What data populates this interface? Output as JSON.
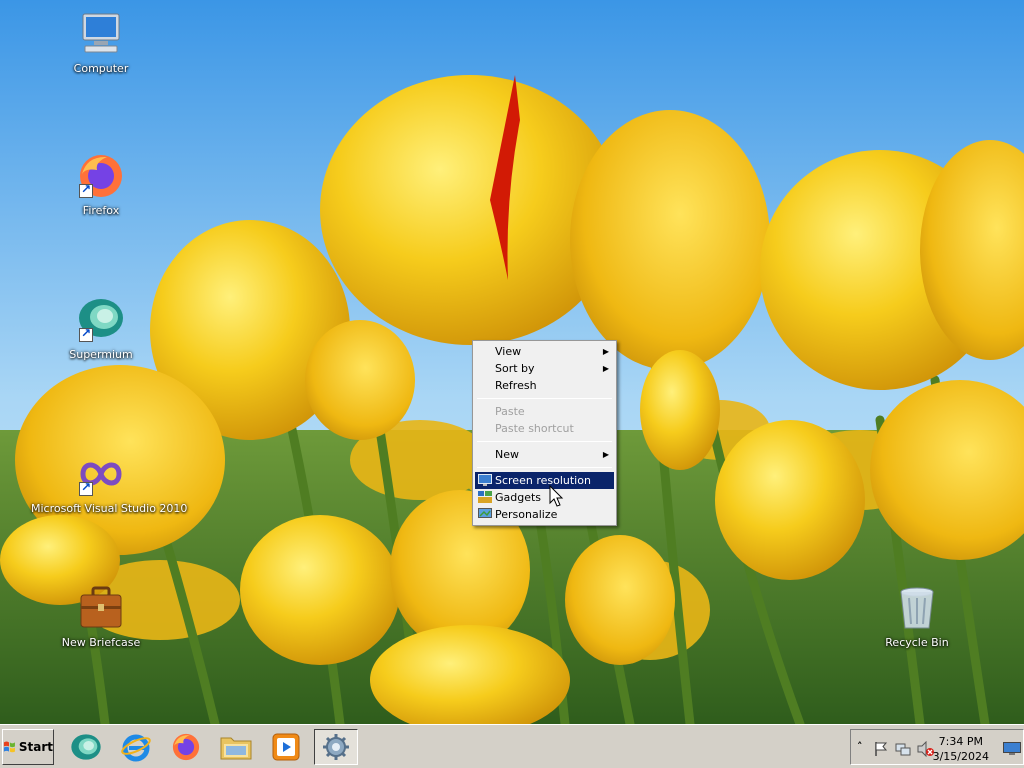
{
  "desktop": {
    "icons": [
      {
        "label": "Computer",
        "icon": "computer-icon"
      },
      {
        "label": "Firefox",
        "icon": "firefox-icon"
      },
      {
        "label": "Supermium",
        "icon": "supermium-icon"
      },
      {
        "label": "Microsoft Visual Studio 2010",
        "icon": "visual-studio-icon"
      },
      {
        "label": "New Briefcase",
        "icon": "briefcase-icon"
      },
      {
        "label": "Recycle Bin",
        "icon": "recycle-bin-icon"
      }
    ]
  },
  "context_menu": {
    "view": "View",
    "sort_by": "Sort by",
    "refresh": "Refresh",
    "paste": "Paste",
    "paste_shortcut": "Paste shortcut",
    "new": "New",
    "screen_resolution": "Screen resolution",
    "gadgets": "Gadgets",
    "personalize": "Personalize"
  },
  "taskbar": {
    "start_label": "Start",
    "pinned": [
      "supermium-icon",
      "internet-explorer-icon",
      "firefox-icon",
      "explorer-folder-icon",
      "media-player-icon",
      "control-panel-icon"
    ],
    "clock_time": "7:34 PM",
    "clock_date": "3/15/2024",
    "tray_icons": [
      "show-hidden-icons",
      "action-center-flag-icon",
      "network-icon",
      "volume-muted-icon"
    ]
  },
  "colors": {
    "menu_highlight": "#0a246a",
    "taskbar_bg": "#d4d0c8",
    "tulip_yellow": "#f2c417"
  }
}
